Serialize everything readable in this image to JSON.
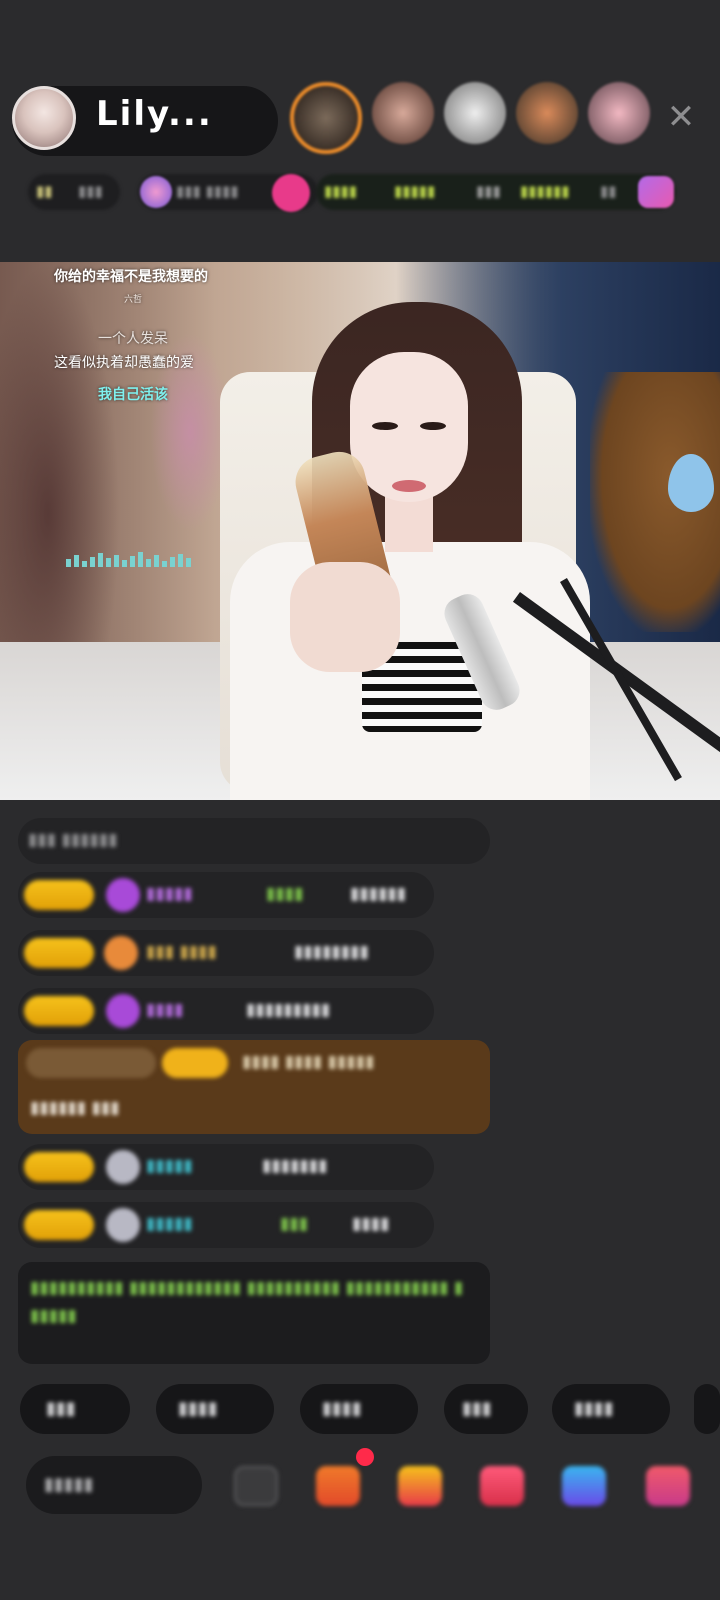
{
  "header": {
    "host_name": "Lily...",
    "close_icon": "close-icon",
    "top_fans": [
      "fan-avatar-1",
      "fan-avatar-2",
      "fan-avatar-3",
      "fan-avatar-4",
      "fan-avatar-5"
    ]
  },
  "badges": {
    "items": [
      "▮▮",
      "▮▮▮",
      "▮▮▮ ▮▮▮▮",
      "▮▮▮▮",
      "▮▮▮▮▮",
      "▮▮▮",
      "▮▮▮▮▮▮",
      "▮▮"
    ]
  },
  "video": {
    "lyrics": {
      "line1": "你给的幸福不是我想要的",
      "line1_sub": "六哲",
      "line2": "一个人发呆",
      "line3": "这看似执着却愚蠢的爱",
      "line4": "我自己活该"
    }
  },
  "chat": {
    "messages": [
      {
        "badge": "▮▮▮",
        "name": "▮▮▮▮▮",
        "extra": "▮▮▮▮",
        "text": "▮▮▮▮▮▮"
      },
      {
        "badge": "▮▮▮",
        "name": "▮▮▮ ▮▮▮▮",
        "extra": "",
        "text": "▮▮▮▮▮▮▮▮"
      },
      {
        "badge": "▮▮▮",
        "name": "▮▮▮▮",
        "extra": "",
        "text": "▮▮▮▮▮▮▮▮▮"
      },
      {
        "badge": "▮▮▮",
        "name": "▮▮▮▮▮",
        "extra": "",
        "text": "▮▮▮▮▮▮▮"
      },
      {
        "badge": "▮▮▮",
        "name": "▮▮▮▮▮",
        "extra": "▮▮▮",
        "text": "▮▮▮▮"
      }
    ],
    "top_line": "▮▮▮ ▮▮▮▮▮▮",
    "system_line1": "▮▮▮▮ ▮▮▮▮ ▮▮▮▮▮",
    "system_line2": "▮▮▮▮▮▮ ▮▮▮",
    "notice": "▮▮▮▮▮▮▮▮▮▮ ▮▮▮▮▮▮▮▮▮▮▮▮ ▮▮▮▮▮▮▮▮▮▮ ▮▮▮▮▮▮▮▮▮▮▮ ▮▮▮▮▮▮"
  },
  "quick_replies": [
    "▮▮▮",
    "▮▮▮▮",
    "▮▮▮▮",
    "▮▮▮",
    "▮▮▮▮"
  ],
  "bottom": {
    "input_placeholder": "▮▮▮▮▮",
    "icons": [
      "emoji-icon",
      "gift-box-icon",
      "treasure-chest-icon",
      "pk-icon",
      "game-icon",
      "more-icon"
    ]
  },
  "colors": {
    "background": "#2b2b2d",
    "level_badge": "#f6c21b",
    "name_purple": "#b06ad8",
    "name_teal": "#3fb7c4",
    "notice_green": "#7bbf4a",
    "red_dot": "#ff2a4a"
  }
}
